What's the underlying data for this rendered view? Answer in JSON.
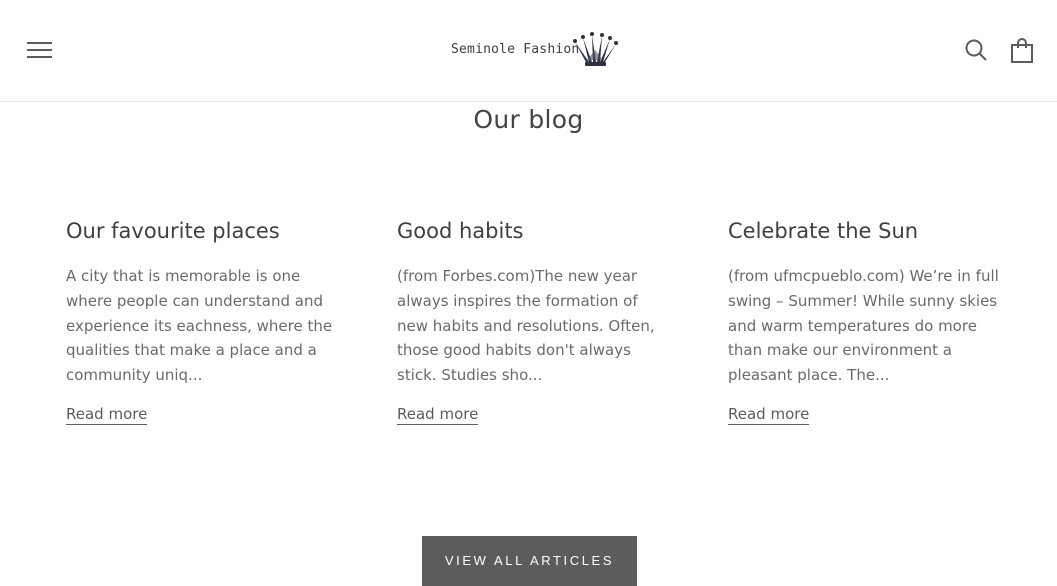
{
  "header": {
    "logo_text": "Seminole Fashion",
    "menu_icon": "hamburger-menu-icon",
    "search_icon": "search-icon",
    "cart_icon": "shopping-bag-icon"
  },
  "section": {
    "title": "Our blog"
  },
  "articles": [
    {
      "title": "Our favourite places",
      "excerpt": "A city that is memorable is one where people can understand and experience its eachness, where the qualities that make a place and a community uniq...",
      "read_more": "Read more"
    },
    {
      "title": "Good habits",
      "excerpt": "(from Forbes.com)The new year always inspires the formation of new habits and resolutions. Often, those good habits don't always stick. Studies sho...",
      "read_more": "Read more"
    },
    {
      "title": "Celebrate the Sun",
      "excerpt": "(from ufmcpueblo.com) We’re in full swing – Summer! While sunny skies and warm temperatures do more than make our environment a pleasant place. The...",
      "read_more": "Read more"
    }
  ],
  "view_all_label": "VIEW ALL ARTICLES",
  "colors": {
    "button_bg": "#5c5c5c",
    "text": "#5c5c5c",
    "heading": "#3f3f3f"
  }
}
